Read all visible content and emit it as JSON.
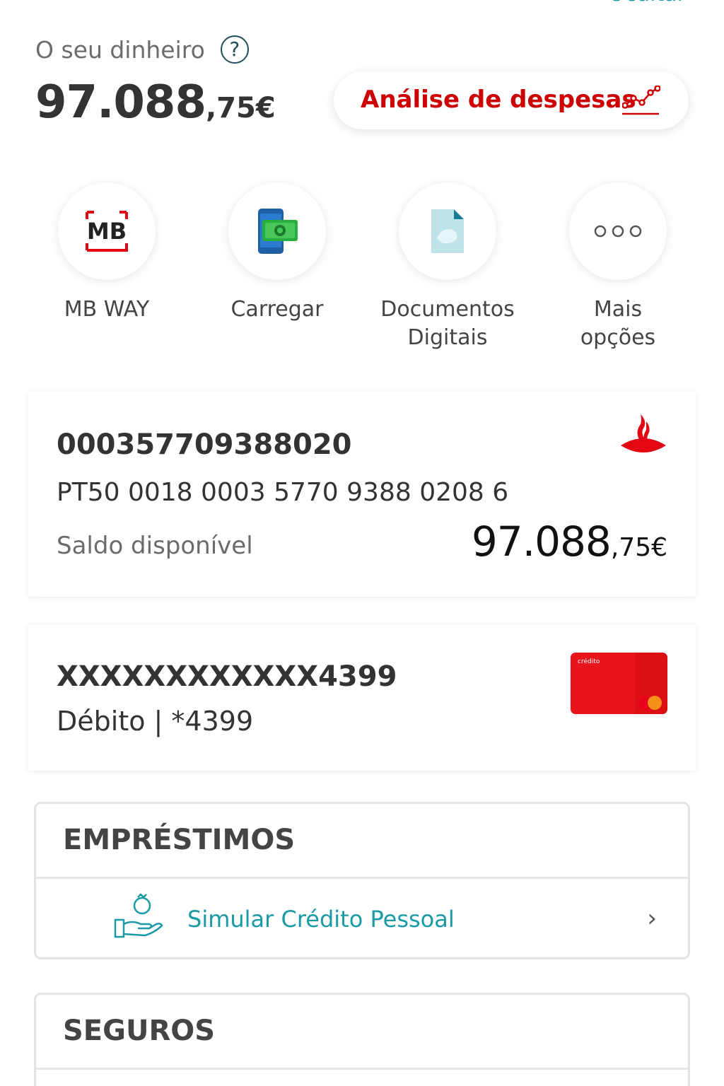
{
  "header": {
    "hide_link": "Ocultar"
  },
  "balance": {
    "label": "O seu dinheiro",
    "help_symbol": "?",
    "value_int": "97.088",
    "value_dec": ",75€",
    "expense_button": "Análise de despesas"
  },
  "quick_actions": [
    {
      "label": "MB WAY",
      "icon": "mbway-icon"
    },
    {
      "label": "Carregar",
      "icon": "topup-phone-icon"
    },
    {
      "label": "Documentos\nDigitais",
      "icon": "document-icon"
    },
    {
      "label": "Mais\nopções",
      "icon": "more-icon"
    }
  ],
  "mbway_logo_text": "MB",
  "account": {
    "number": "000357709388020",
    "iban": "PT50 0018 0003 5770 9388 0208 6",
    "available_label": "Saldo disponível",
    "available_int": "97.088",
    "available_dec": ",75€"
  },
  "card": {
    "number": "XXXXXXXXXXXX4399",
    "type": "Débito | *4399",
    "thumb_brand": "crédito"
  },
  "loans": {
    "title": "EMPRÉSTIMOS",
    "row_label": "Simular Crédito Pessoal",
    "chevron": "›"
  },
  "insurance": {
    "title": "SEGUROS"
  },
  "colors": {
    "brand_red": "#cc0000",
    "teal": "#1a9aa5",
    "card_red": "#e8141b"
  }
}
